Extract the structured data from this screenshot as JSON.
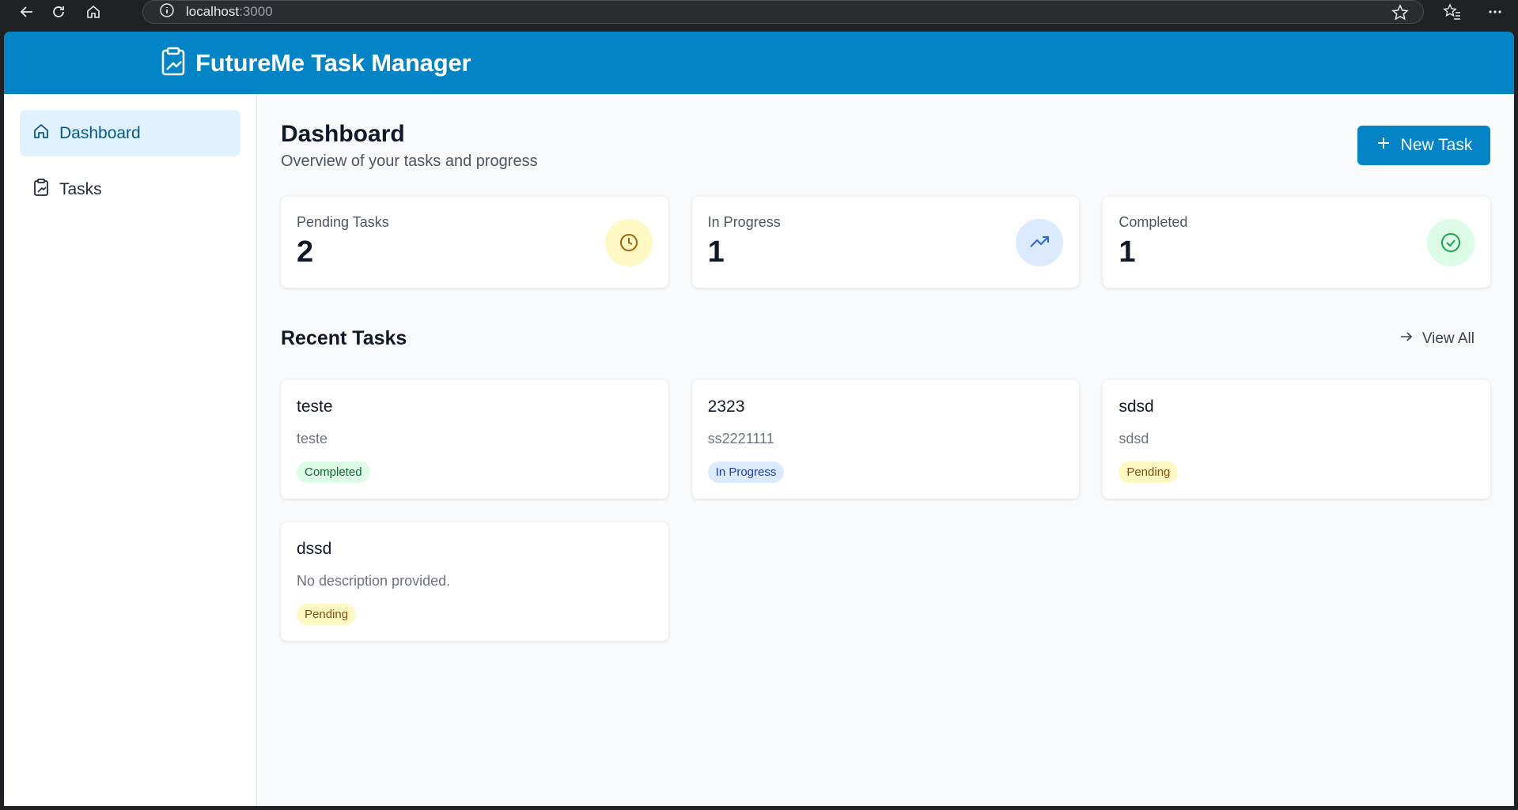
{
  "browser": {
    "url_host": "localhost",
    "url_port": ":3000"
  },
  "app": {
    "title": "FutureMe Task Manager"
  },
  "sidebar": {
    "items": [
      {
        "label": "Dashboard",
        "icon": "home-icon",
        "active": true
      },
      {
        "label": "Tasks",
        "icon": "clipboard-icon",
        "active": false
      }
    ]
  },
  "page": {
    "title": "Dashboard",
    "subtitle": "Overview of your tasks and progress",
    "new_task_label": "New Task"
  },
  "stats": [
    {
      "label": "Pending Tasks",
      "value": "2",
      "icon": "clock-icon",
      "icon_bg": "#fef9c3",
      "icon_color": "#a16207"
    },
    {
      "label": "In Progress",
      "value": "1",
      "icon": "trending-up-icon",
      "icon_bg": "#dbeafe",
      "icon_color": "#2563eb"
    },
    {
      "label": "Completed",
      "value": "1",
      "icon": "check-circle-icon",
      "icon_bg": "#dcfce7",
      "icon_color": "#16a34a"
    }
  ],
  "recent": {
    "title": "Recent Tasks",
    "view_all_label": "View All"
  },
  "tasks": [
    {
      "title": "teste",
      "description": "teste",
      "status": "Completed",
      "badge_bg": "#dcfce7",
      "badge_color": "#166534"
    },
    {
      "title": "2323",
      "description": "ss2221111",
      "status": "In Progress",
      "badge_bg": "#dbeafe",
      "badge_color": "#1e40af"
    },
    {
      "title": "sdsd",
      "description": "sdsd",
      "status": "Pending",
      "badge_bg": "#fef9c3",
      "badge_color": "#854d0e"
    },
    {
      "title": "dssd",
      "description": "No description provided.",
      "status": "Pending",
      "badge_bg": "#fef9c3",
      "badge_color": "#854d0e"
    }
  ],
  "colors": {
    "brand": "#0284c7",
    "sidebar_active_bg": "#e0f2fe"
  }
}
